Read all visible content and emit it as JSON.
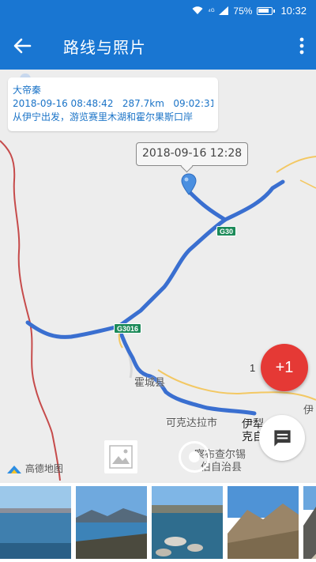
{
  "status": {
    "signal": "⁴ᴳ",
    "battery": "75%",
    "time": "10:32"
  },
  "appbar": {
    "title": "路线与照片",
    "back_icon": "arrow-back-icon",
    "more_icon": "more-vert-icon"
  },
  "trip": {
    "name": "大帝秦",
    "start": "2018-09-16 08:48:42",
    "distance": "287.7km",
    "duration": "09:02:31",
    "description": "从伊宁出发，游览赛里木湖和霍尔果斯口岸"
  },
  "marker_tooltip": "2018-09-16 12:28",
  "road_shields": [
    "G30",
    "G3016"
  ],
  "map_labels": {
    "huocheng": "霍城县",
    "kekedala": "可克达拉市",
    "chabuchaer_1": "察布查尔锡",
    "chabuchaer_2": "伯自治县",
    "yili_1": "伊犁",
    "yili_2": "克自",
    "yi_edge": "伊"
  },
  "fab": {
    "label": "+1",
    "side_text": "1"
  },
  "map_provider": "高德地图",
  "photos": [
    {
      "scene": "lake-shore"
    },
    {
      "scene": "lake-mountains"
    },
    {
      "scene": "lake-rocks"
    },
    {
      "scene": "grassland-hills"
    },
    {
      "scene": "mountain-road"
    }
  ],
  "colors": {
    "appbar": "#1976d2",
    "route": "#3a6fd0",
    "fab": "#e53935",
    "card_text": "#1a73c7"
  }
}
